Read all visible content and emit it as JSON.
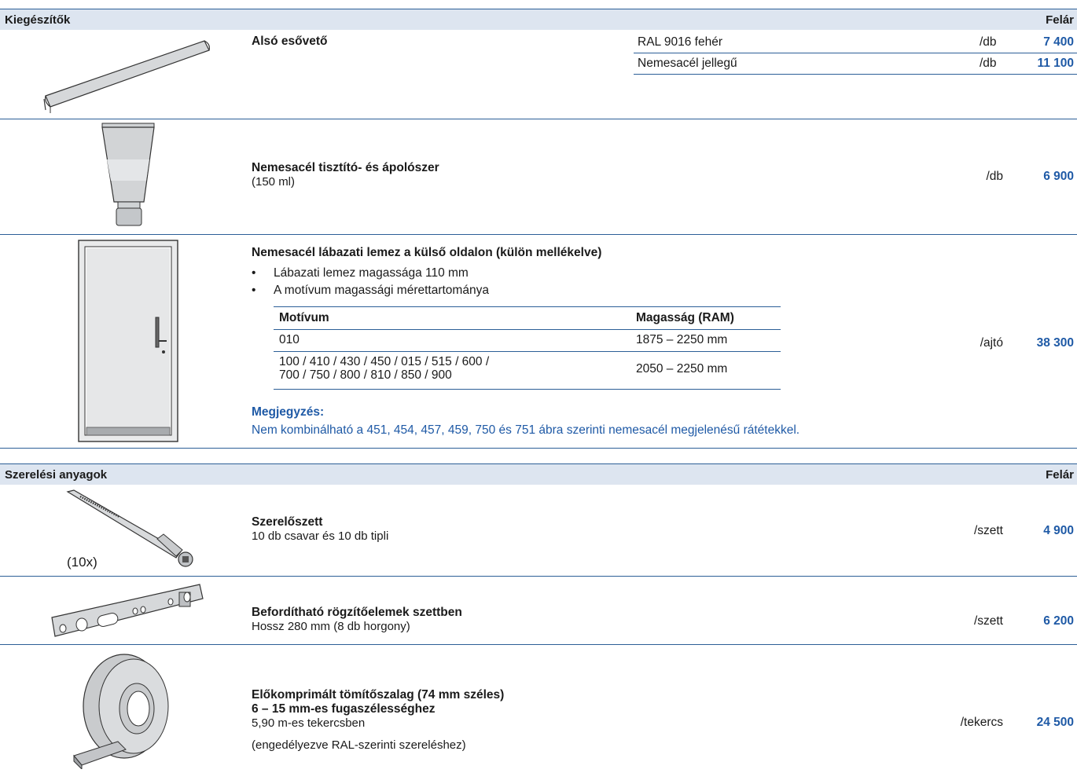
{
  "sections": [
    {
      "title": "Kiegészítők",
      "price_header": "Felár",
      "items": [
        {
          "title": "Alsó esővető",
          "variants": [
            {
              "label": "RAL 9016 fehér",
              "unit": "/db",
              "price": "7 400"
            },
            {
              "label": "Nemesacél jellegű",
              "unit": "/db",
              "price": "11 100"
            }
          ]
        },
        {
          "title": "Nemesacél tisztító- és ápolószer",
          "subtitle": "(150 ml)",
          "unit": "/db",
          "price": "6 900"
        },
        {
          "title": "Nemesacél lábazati lemez a külső oldalon (külön mellékelve)",
          "bullets": [
            "Lábazati lemez magassága 110 mm",
            "A motívum magassági mérettartománya"
          ],
          "table": {
            "headers": [
              "Motívum",
              "Magasság (RAM)"
            ],
            "rows": [
              {
                "motif": "010",
                "height": "1875 – 2250 mm"
              },
              {
                "motif_line1": "100 / 410 / 430 / 450 / 015 / 515 / 600 /",
                "motif_line2": "700 / 750 / 800 / 810 / 850 / 900",
                "height": "2050 – 2250 mm"
              }
            ]
          },
          "note_title": "Megjegyzés:",
          "note_text": "Nem kombinálható a 451, 454, 457, 459, 750 és 751 ábra szerinti nemesacél megjelenésű rátétekkel.",
          "unit": "/ajtó",
          "price": "38 300"
        }
      ]
    },
    {
      "title": "Szerelési anyagok",
      "price_header": "Felár",
      "items": [
        {
          "image_caption": "(10x)",
          "title": "Szerelőszett",
          "subtitle": "10 db csavar és 10 db tipli",
          "unit": "/szett",
          "price": "4 900"
        },
        {
          "title": "Befordítható rögzítőelemek szettben",
          "subtitle": "Hossz 280 mm (8 db horgony)",
          "unit": "/szett",
          "price": "6 200"
        },
        {
          "title": "Előkomprimált tömítőszalag (74 mm széles)",
          "title2": "6 – 15 mm-es fugaszélességhez",
          "subtitle": "5,90 m-es tekercsben",
          "note": "(engedélyezve RAL-szerinti szereléshez)",
          "unit": "/tekercs",
          "price": "24 500"
        }
      ]
    }
  ],
  "colors": {
    "accent": "#1f5aa6",
    "header_bg": "#dde5f0",
    "rule": "#2c5f97"
  }
}
